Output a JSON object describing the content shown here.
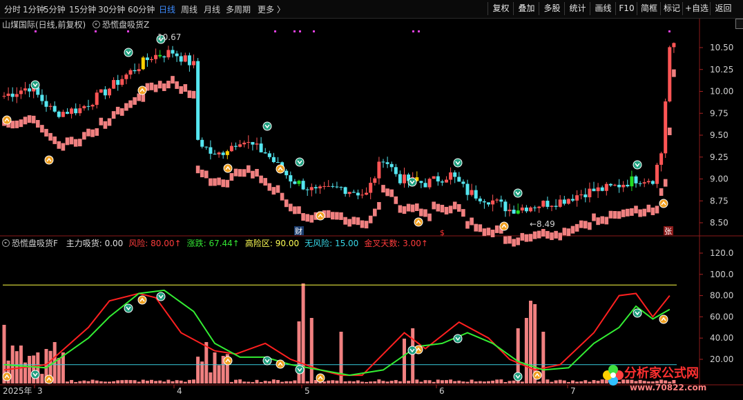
{
  "toolbar": {
    "left_items": [
      "分时",
      "1分钟",
      "5分钟",
      "15分钟",
      "30分钟",
      "60分钟",
      "日线",
      "周线",
      "月线",
      "多周期",
      "更多 〉"
    ],
    "active": "日线",
    "right_items": [
      "复权",
      "叠加",
      "多股",
      "统计",
      "画线",
      "F10",
      "简框",
      "标记",
      "+自选",
      "返回"
    ]
  },
  "main_header": {
    "stock": "山煤国际(日线,前复权)",
    "indicator": "恐慌盘吸货Z"
  },
  "sub_header": {
    "name": "恐慌盘吸货F",
    "items": [
      {
        "label": "主力吸货: 0.00",
        "color": "#e0e0e0"
      },
      {
        "label": "风险: 80.00↑",
        "color": "#ff3c3c"
      },
      {
        "label": "涨跌: 67.44↑",
        "color": "#33e633"
      },
      {
        "label": "高险区: 90.00",
        "color": "#ffff55"
      },
      {
        "label": "无风险: 15.00",
        "color": "#38d8e8"
      },
      {
        "label": "金叉天数: 3.00↑",
        "color": "#ff3c3c"
      }
    ]
  },
  "price_axis": [
    "10.50",
    "10.25",
    "10.00",
    "9.75",
    "9.50",
    "9.25",
    "9.00",
    "8.75",
    "8.50"
  ],
  "osc_axis": [
    "120.0",
    "100.0",
    "80.00",
    "60.00",
    "40.00",
    "20.00"
  ],
  "annotations": {
    "high": "10.67",
    "low": "←8.49",
    "cai": "财",
    "s": "$",
    "zhang": "张"
  },
  "date_axis": [
    "2025年",
    "3",
    "4",
    "5",
    "6",
    "7"
  ],
  "watermark": "分析家公式网",
  "watermark_url": "www.70822.com",
  "colors": {
    "up": "#ff5555",
    "down": "#55e6f0",
    "volume": "#f08080",
    "red_line": "#ff2020",
    "green_line": "#33ee33",
    "yellow_line": "#ffff44",
    "cyan_line": "#38d0e0"
  }
}
